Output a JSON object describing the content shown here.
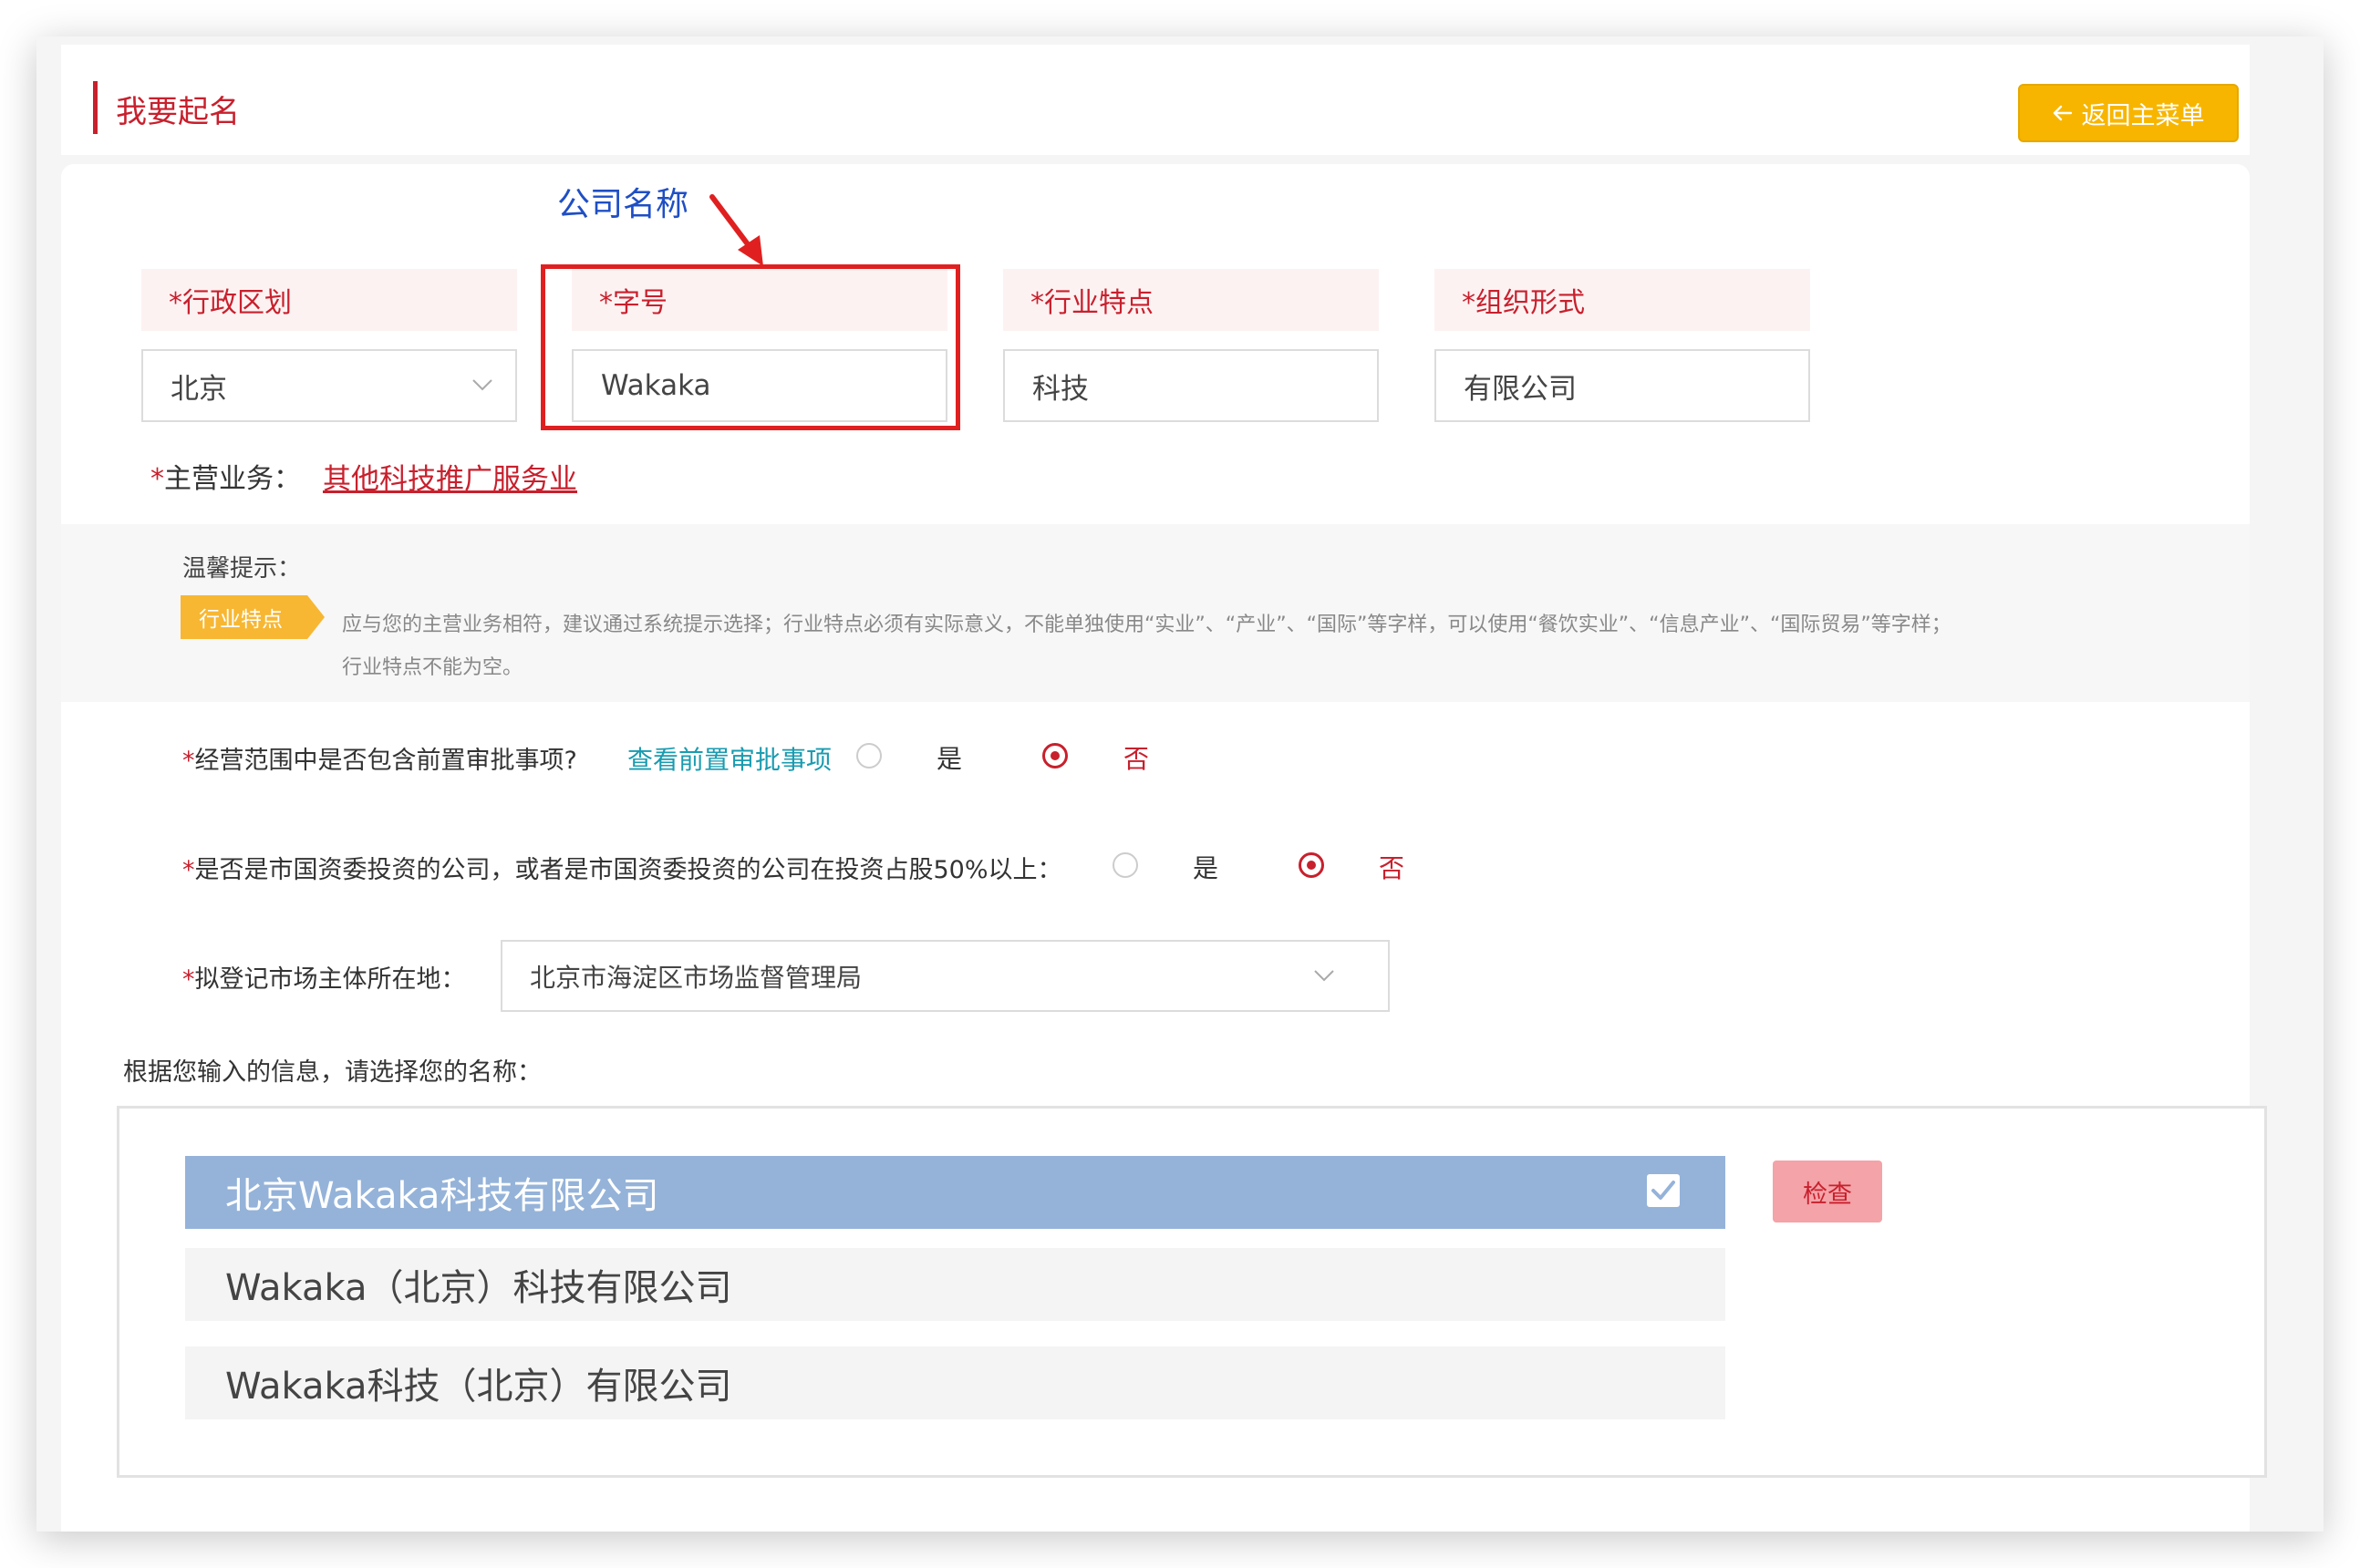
{
  "header": {
    "title": "我要起名",
    "back_label": "返回主菜单"
  },
  "annotation": {
    "label": "公司名称"
  },
  "fields": {
    "region": {
      "label": "*行政区划",
      "value": "北京"
    },
    "trade_name": {
      "label": "*字号",
      "value": "Wakaka"
    },
    "industry": {
      "label": "*行业特点",
      "value": "科技"
    },
    "org_form": {
      "label": "*组织形式",
      "value": "有限公司"
    }
  },
  "main_business": {
    "label": "主营业务：",
    "value": "其他科技推广服务业"
  },
  "tips": {
    "title": "温馨提示：",
    "badge": "行业特点",
    "line1": "应与您的主营业务相符，建议通过系统提示选择；行业特点必须有实际意义，不能单独使用“实业”、“产业”、“国际”等字样，可以使用“餐饮实业”、“信息产业”、“国际贸易”等字样；",
    "line2": "行业特点不能为空。"
  },
  "questions": {
    "q1": {
      "label": "经营范围中是否包含前置审批事项?",
      "link": "查看前置审批事项",
      "yes": "是",
      "no": "否",
      "selected": "否"
    },
    "q2": {
      "label": "是否是市国资委投资的公司，或者是市国资委投资的公司在投资占股50%以上：",
      "yes": "是",
      "no": "否",
      "selected": "否"
    },
    "q3": {
      "label": "拟登记市场主体所在地：",
      "value": "北京市海淀区市场监督管理局"
    }
  },
  "names": {
    "prompt": "根据您输入的信息，请选择您的名称：",
    "options": [
      "北京Wakaka科技有限公司",
      "Wakaka（北京）科技有限公司",
      "Wakaka科技（北京）有限公司"
    ],
    "selected_index": 0,
    "check_label": "检查"
  },
  "colors": {
    "brand_red": "#c8202d",
    "accent_yellow": "#f7b500",
    "selected_blue": "#95b3d9",
    "annotation_blue": "#1f4fc4"
  }
}
